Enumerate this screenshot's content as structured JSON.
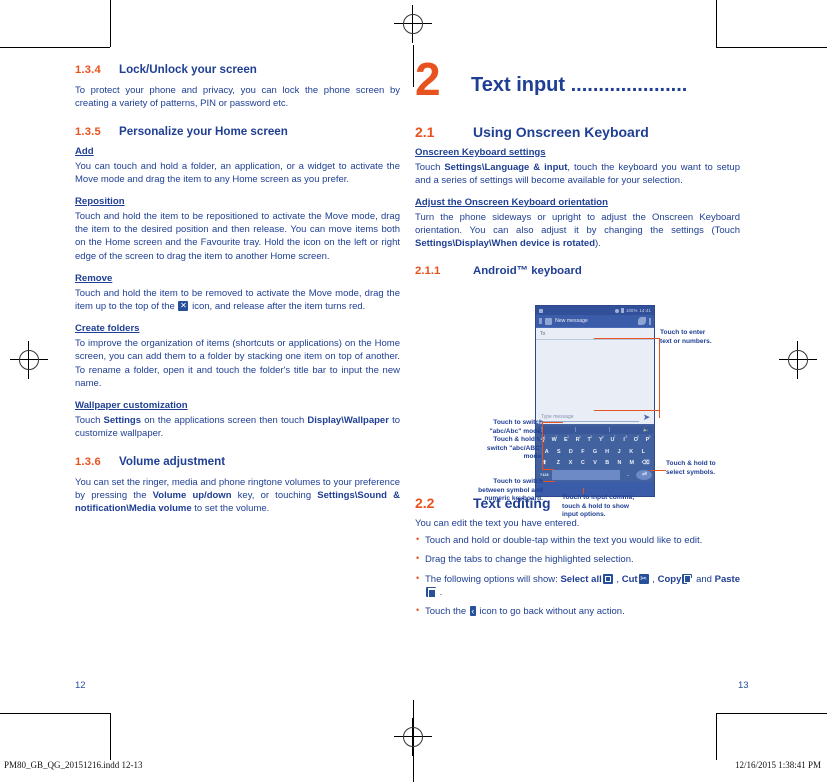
{
  "document": {
    "left_page_number": "12",
    "right_page_number": "13",
    "slug_left": "PM80_GB_QG_20151216.indd   12-13",
    "slug_right": "12/16/2015   1:38:41 PM"
  },
  "colors": {
    "accent_orange": "#e8521e",
    "text_blue": "#1f3f94",
    "phone_blue": "#3b5ca8",
    "keyboard_blue": "#42629f"
  },
  "left_page": {
    "sections": [
      {
        "number": "1.3.4",
        "title": "Lock/Unlock your screen",
        "body": "To protect your phone and privacy, you can lock the phone screen by creating a variety of patterns, PIN or password etc."
      },
      {
        "number": "1.3.5",
        "title": "Personalize your Home screen"
      },
      {
        "number": "1.3.6",
        "title": "Volume adjustment"
      }
    ],
    "add": {
      "heading": "Add",
      "body": "You can touch and hold a folder, an application, or a widget to activate the Move mode and drag the item to any Home screen as you prefer."
    },
    "reposition": {
      "heading": "Reposition ",
      "body": "Touch and hold the item to be repositioned to activate the Move mode, drag the item to the desired position and then release. You can move items both on the Home screen and the Favourite tray. Hold the icon on the left or right edge of the screen to drag the item to another Home screen."
    },
    "remove": {
      "heading": "Remove",
      "body_before": "Touch and hold the item to be removed to activate the Move mode, drag the item up to the top of the ",
      "icon": "close-x-icon",
      "body_after": " icon, and release after the item turns red."
    },
    "create_folders": {
      "heading": "Create folders",
      "body": "To improve the organization of items (shortcuts or applications) on the Home screen, you can add them to a folder by stacking one item on top of another. To rename a folder, open it and touch the folder's title bar to input the new name."
    },
    "wallpaper": {
      "heading": "Wallpaper customization",
      "body_1": "Touch ",
      "bold_1": "Settings",
      "body_2": " on the applications screen then touch ",
      "bold_2": "Display\\Wallpaper",
      "body_3": " to customize wallpaper."
    },
    "volume": {
      "body_1": "You can set the ringer, media and phone ringtone volumes to your preference by pressing the ",
      "bold_1": "Volume up/down",
      "body_2": " key, or touching ",
      "bold_2": "Settings\\Sound & notification\\Media volume",
      "body_3": " to set the volume."
    }
  },
  "right_page": {
    "chapter": {
      "number": "2",
      "title": "Text input ....................."
    },
    "section_2_1": {
      "number": "2.1",
      "title": "Using Onscreen Keyboard"
    },
    "onscreen_settings": {
      "heading": "Onscreen Keyboard settings",
      "body_1": "Touch ",
      "bold_1": "Settings\\Language & input",
      "body_2": ", touch the keyboard you want to setup and a series of settings will become available for your selection."
    },
    "orientation": {
      "heading": "Adjust the Onscreen Keyboard orientation",
      "body_1": "Turn the phone sideways or upright to adjust the Onscreen Keyboard orientation. You can also adjust it by changing the settings (Touch ",
      "bold_1": "Settings\\Display\\When device is rotated",
      "body_2": ")."
    },
    "section_2_1_1": {
      "number": "2.1.1",
      "title": "Android™ keyboard"
    },
    "section_2_2": {
      "number": "2.2",
      "title": "Text editing"
    },
    "text_editing": {
      "intro": "You can edit the text you have entered.",
      "bullets": [
        {
          "text": "Touch and hold or double-tap within the text you would like to edit."
        },
        {
          "text": "Drag the tabs to change the highlighted selection."
        },
        {
          "parts": [
            "The following options will show: ",
            "Select all",
            " , ",
            "Cut",
            " , ",
            "Copy",
            " and ",
            "Paste",
            " ."
          ],
          "icons": [
            "select-all-icon",
            "cut-icon",
            "copy-icon",
            "paste-icon"
          ]
        },
        {
          "parts": [
            "Touch the ",
            " icon to go back without any action."
          ],
          "icons": [
            "back-arrow-icon"
          ]
        }
      ]
    }
  },
  "figure": {
    "name": "android-keyboard-screenshot",
    "statusbar": {
      "left_icon": "sim-icon",
      "battery": "100%",
      "time": "14:41"
    },
    "actionbar": {
      "back": "back-icon",
      "avatar": "contact-icon",
      "title": "New message",
      "attach": "attachment-icon",
      "menu": "overflow-menu-icon"
    },
    "to_field": {
      "label": "To"
    },
    "composer": {
      "placeholder": "Type message",
      "send": "send-icon"
    },
    "keyboard": {
      "row1": [
        {
          "key": "Q",
          "sup": "1"
        },
        {
          "key": "W",
          "sup": "2"
        },
        {
          "key": "E",
          "sup": "3"
        },
        {
          "key": "R",
          "sup": "4"
        },
        {
          "key": "T",
          "sup": "5"
        },
        {
          "key": "Y",
          "sup": "6"
        },
        {
          "key": "U",
          "sup": "7"
        },
        {
          "key": "I",
          "sup": "8"
        },
        {
          "key": "O",
          "sup": "9"
        },
        {
          "key": "P",
          "sup": "0"
        }
      ],
      "row2": [
        "A",
        "S",
        "D",
        "F",
        "G",
        "H",
        "J",
        "K",
        "L"
      ],
      "row3": {
        "shift": "shift-icon",
        "keys": [
          "Z",
          "X",
          "C",
          "V",
          "B",
          "N",
          "M"
        ],
        "delete": "backspace-icon"
      },
      "row4": {
        "sym": "?123",
        "space": "",
        "period": ".",
        "enter": "enter-icon"
      },
      "suggestion_mic": "mic-icon"
    },
    "callouts": {
      "enter_text": "Touch to enter\ntext or numbers.",
      "select_symbols": "Touch & hold to\nselect symbols.",
      "switch_case": "Touch to switch\n\"abc/Abc\" mode;\nTouch & hold to\nswitch \"abc/ABC\"\nmode.",
      "switch_symbol": "Touch to switch\nbetween symbol and\nnumeric keyboard.",
      "input_comma": "Touch to input comma;\ntouch & hold to show\ninput options."
    }
  }
}
